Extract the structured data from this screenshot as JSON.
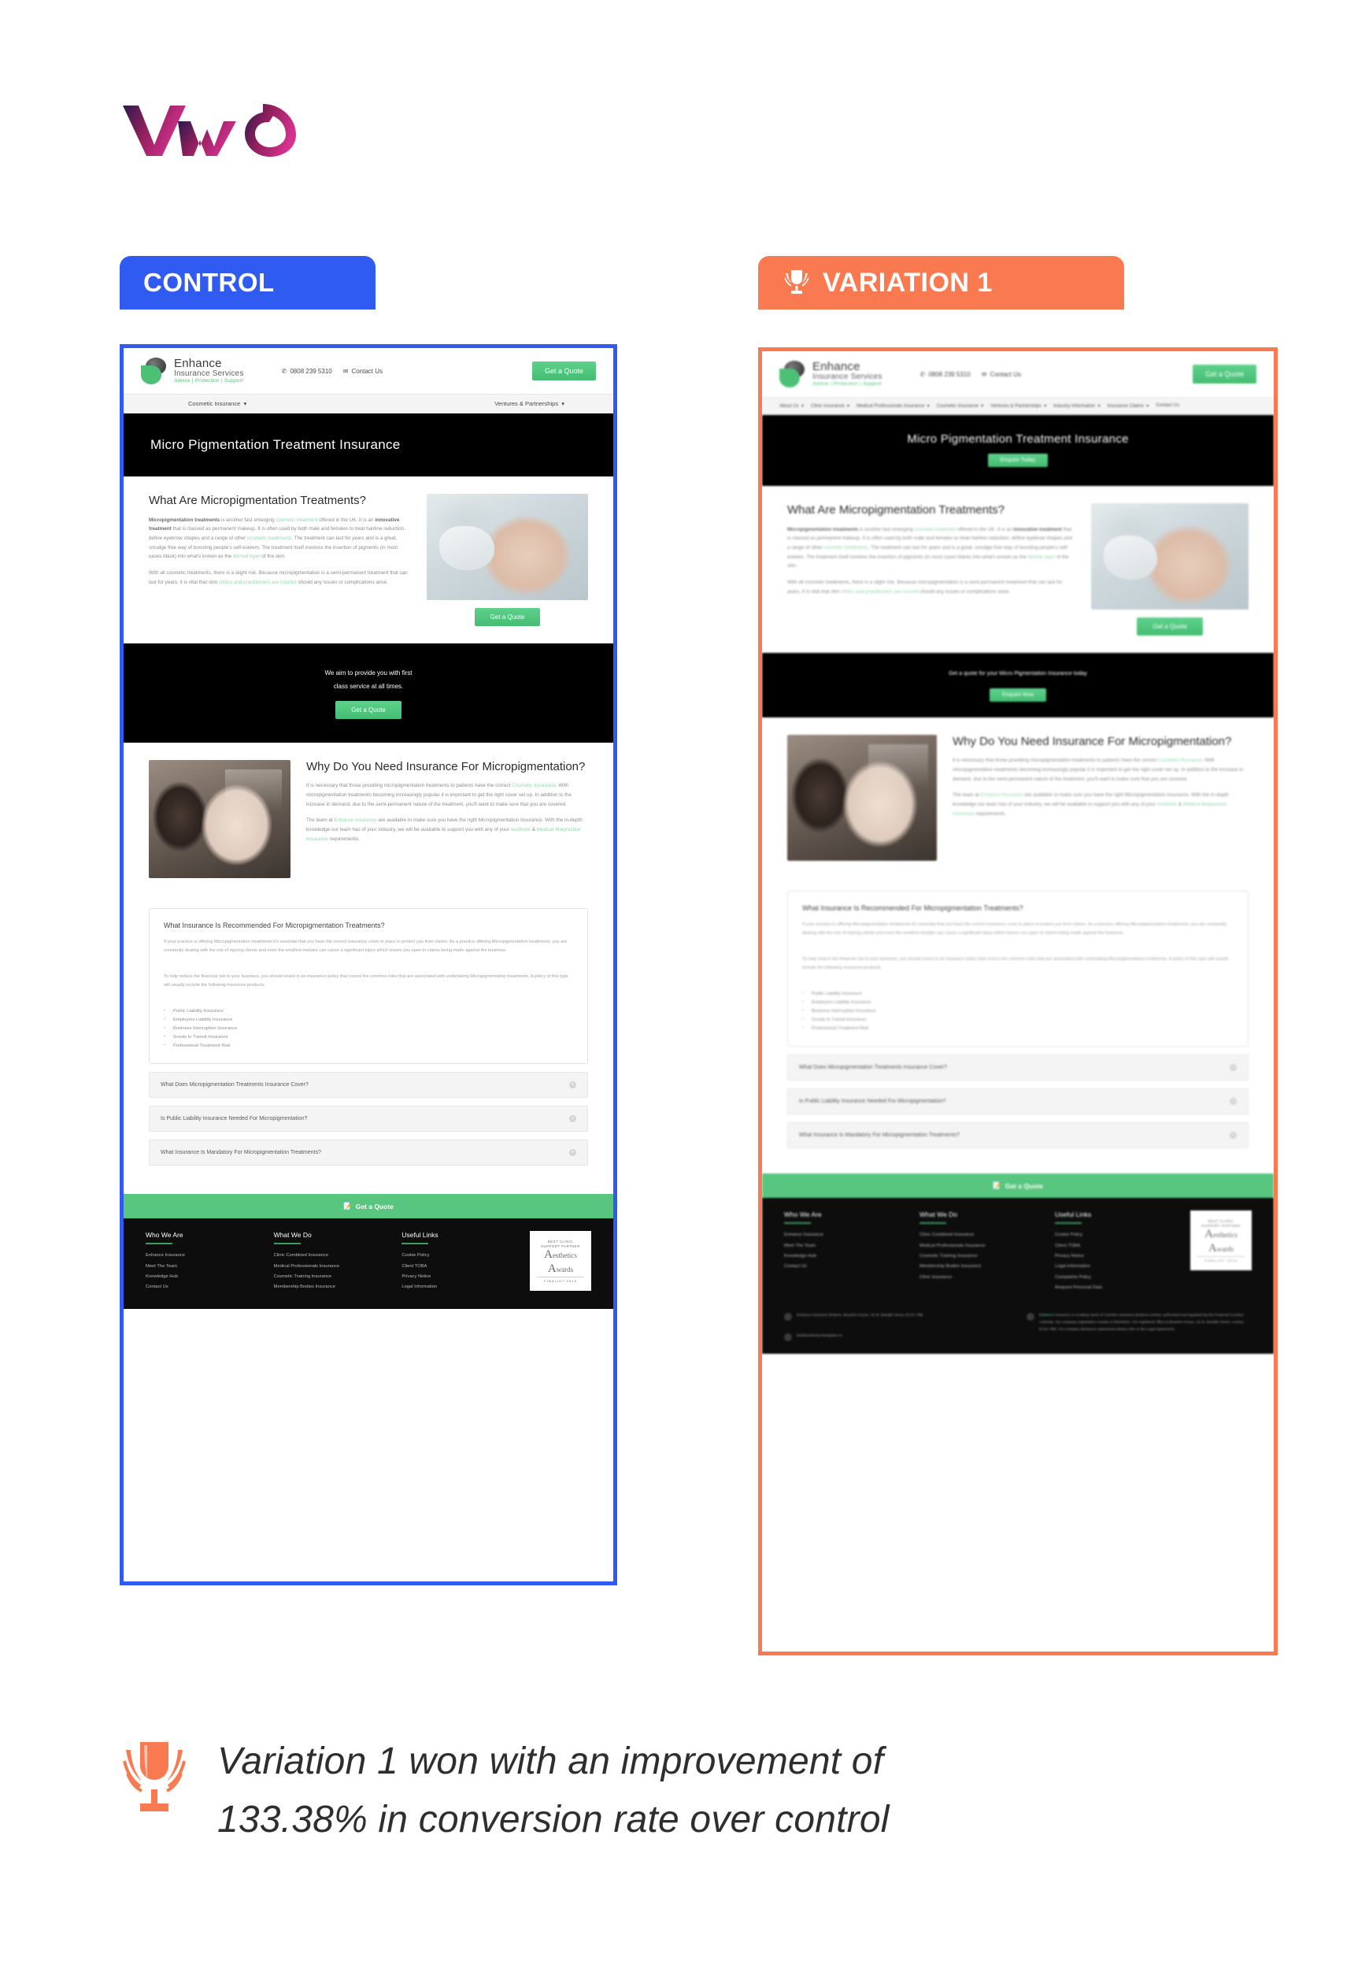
{
  "brand": {
    "logo_alt": "VWO"
  },
  "panels": {
    "control": {
      "tab_label": "CONTROL",
      "accent": "#2f5bf0"
    },
    "variation": {
      "tab_label": "VARIATION 1",
      "accent": "#f97a50",
      "trophy_icon": "trophy-icon"
    }
  },
  "site": {
    "brand_name": "Enhance",
    "brand_sub": "Insurance Services",
    "brand_tagline": "Advice | Protection | Support",
    "phone": "0808 239 5310",
    "contact_label": "Contact Us",
    "quote_button": "Get a Quote",
    "nav_control": [
      "Cosmetic Insurance",
      "Ventures & Partnerships"
    ],
    "nav_variation": [
      "About Us",
      "Clinic Insurance",
      "Medical Professionals Insurance",
      "Cosmetic Insurance",
      "Ventures & Partnerships",
      "Industry Information",
      "Insurance Claims",
      "Contact Us"
    ]
  },
  "hero": {
    "title": "Micro Pigmentation Treatment Insurance",
    "variation_button": "Enquire Today"
  },
  "section_what": {
    "heading": "What Are Micropigmentation Treatments?",
    "para1_html": "<b>Micropigmentation treatments</b> is another fast emerging <span class=\"lnk\">cosmetic treatment</span> offered in the UK. It is an <b>innovative treatment</b> that is classed as permanent makeup. It is often used by both male and females to treat hairline reduction, define eyebrow shapes and a range of other <span class=\"lnk\">cosmetic treatments</span>. The treatment can last for years and is a great, smudge free way of boosting people's self-esteem. The treatment itself involves the insertion of pigments (in most cases black) into what's known as the <span class=\"lnk\">dermal layer</span> of the skin.",
    "para2_html": "With all cosmetic treatments, there is a slight risk. Because micropigmentation is a semi-permanent treatment that can last for years, it is vital that skin <span class=\"lnk\">clinics and practitioners are insured</span> should any issues or complications arise.",
    "button": "Get a Quote"
  },
  "band_control": {
    "line1": "We aim to provide you with first",
    "line2": "class service at all times.",
    "button": "Get a Quote"
  },
  "band_variation": {
    "line1": "Get a quote for your Micro Pigmentation Insurance today",
    "button": "Enquire Now"
  },
  "section_why": {
    "heading": "Why Do You Need Insurance For Micropigmentation?",
    "para1_html": "It is necessary that those providing micropigmentation treatments to patients have the correct <span class=\"lnk\">Cosmetic Insurance</span>. With micropigmentation treatments becoming increasingly popular it is important to get the right cover set up. In addition to the increase in demand, due to the semi-permanent nature of the treatment, you'll want to make sure that you are covered.",
    "para2_html": "The team at <span class=\"lnk\">Enhance Insurance</span> are available to make sure you have the right Micropigmentation Insurance. With the in-depth knowledge our team has of your industry, we will be available to support you with any of your <span class=\"lnk\">Aesthetic</span> &amp; <span class=\"lnk\">Medical Malpractice Insurance</span> requirements."
  },
  "recommended": {
    "heading": "What Insurance Is Recommended For Micropigmentation Treatments?",
    "para1": "If your practice is offering Micropigmentation treatments it's essential that you have the correct insurance cover in place to protect you from claims. As a practice offering Micropigmentation treatments, you are constantly dealing with the risk of injuring clients and even the smallest mistake can cause a significant injury which leaves you open to claims being made against the business.",
    "para2": "To help reduce the financial risk to your business, you should invest in an insurance policy that covers the common risks that are associated with undertaking Micropigmentation treatments. A policy of this type will usually include the following insurance products:",
    "items": [
      "Public Liability Insurance",
      "Employers Liability Insurance",
      "Business Interruption Insurance",
      "Goods In Transit Insurance",
      "Professional Treatment Risk"
    ]
  },
  "accordions": [
    "What Does Micropigmentation Treatments Insurance Cover?",
    "Is Public Liability Insurance Needed For Micropigmentation?",
    "What Insurance Is Mandatory For Micropigmentation Treatments?"
  ],
  "cta_bar": {
    "label": "Get a Quote",
    "icon": "quote-icon"
  },
  "footer": {
    "columns_control": [
      {
        "title": "Who We Are",
        "links": [
          "Enhance Insurance",
          "Meet The Team",
          "Knowledge Hub",
          "Contact Us"
        ]
      },
      {
        "title": "What We Do",
        "links": [
          "Clinic Combined Insurance",
          "Medical Professionals Insurance",
          "Cosmetic Training Insurance",
          "Membership Bodies Insurance"
        ]
      },
      {
        "title": "Useful Links",
        "links": [
          "Cookie Policy",
          "Client TOBA",
          "Privacy Notice",
          "Legal Information"
        ]
      }
    ],
    "columns_variation": [
      {
        "title": "Who We Are",
        "links": [
          "Enhance Insurance",
          "Meet The Team",
          "Knowledge Hub",
          "Contact Us"
        ]
      },
      {
        "title": "What We Do",
        "links": [
          "Clinic Combined Insurance",
          "Medical Professionals Insurance",
          "Cosmetic Training Insurance",
          "Membership Bodies Insurance",
          "Clinic Insurance"
        ]
      },
      {
        "title": "Useful Links",
        "links": [
          "Cookie Policy",
          "Client TOBA",
          "Privacy Notice",
          "Legal Information",
          "Complaints Policy",
          "Request Personal Data"
        ]
      }
    ],
    "badge": {
      "line1": "BEST CLINIC",
      "line2": "SUPPORT PARTNER",
      "word1": "A",
      "word1b": "esthetics",
      "word2": "A",
      "word2b": "wards",
      "line3": "FINALIST 2018"
    },
    "legal": {
      "address": "Enhance Insurance Brokers, Beaufort House, 15 St. Botolph Street, EC3A 7BB",
      "email": "info@authority.fsaregister.co",
      "disclaimer_prefix": "Enhance",
      "disclaimer": "Insurance is a trading name of Camden Insurance Brokers Limited, authorised and regulated by the Financial Conduct Authority. Our company registration number is 06184623. Our registered office is Beaufort House, 15 St. Botolph Street, London EC3A 7BB. For company disclosure statements please refer to the Legal statements."
    }
  },
  "caption": {
    "line1": "Variation 1 won with an improvement of",
    "line2": "133.38% in conversion rate over control",
    "trophy_icon": "trophy-icon"
  }
}
